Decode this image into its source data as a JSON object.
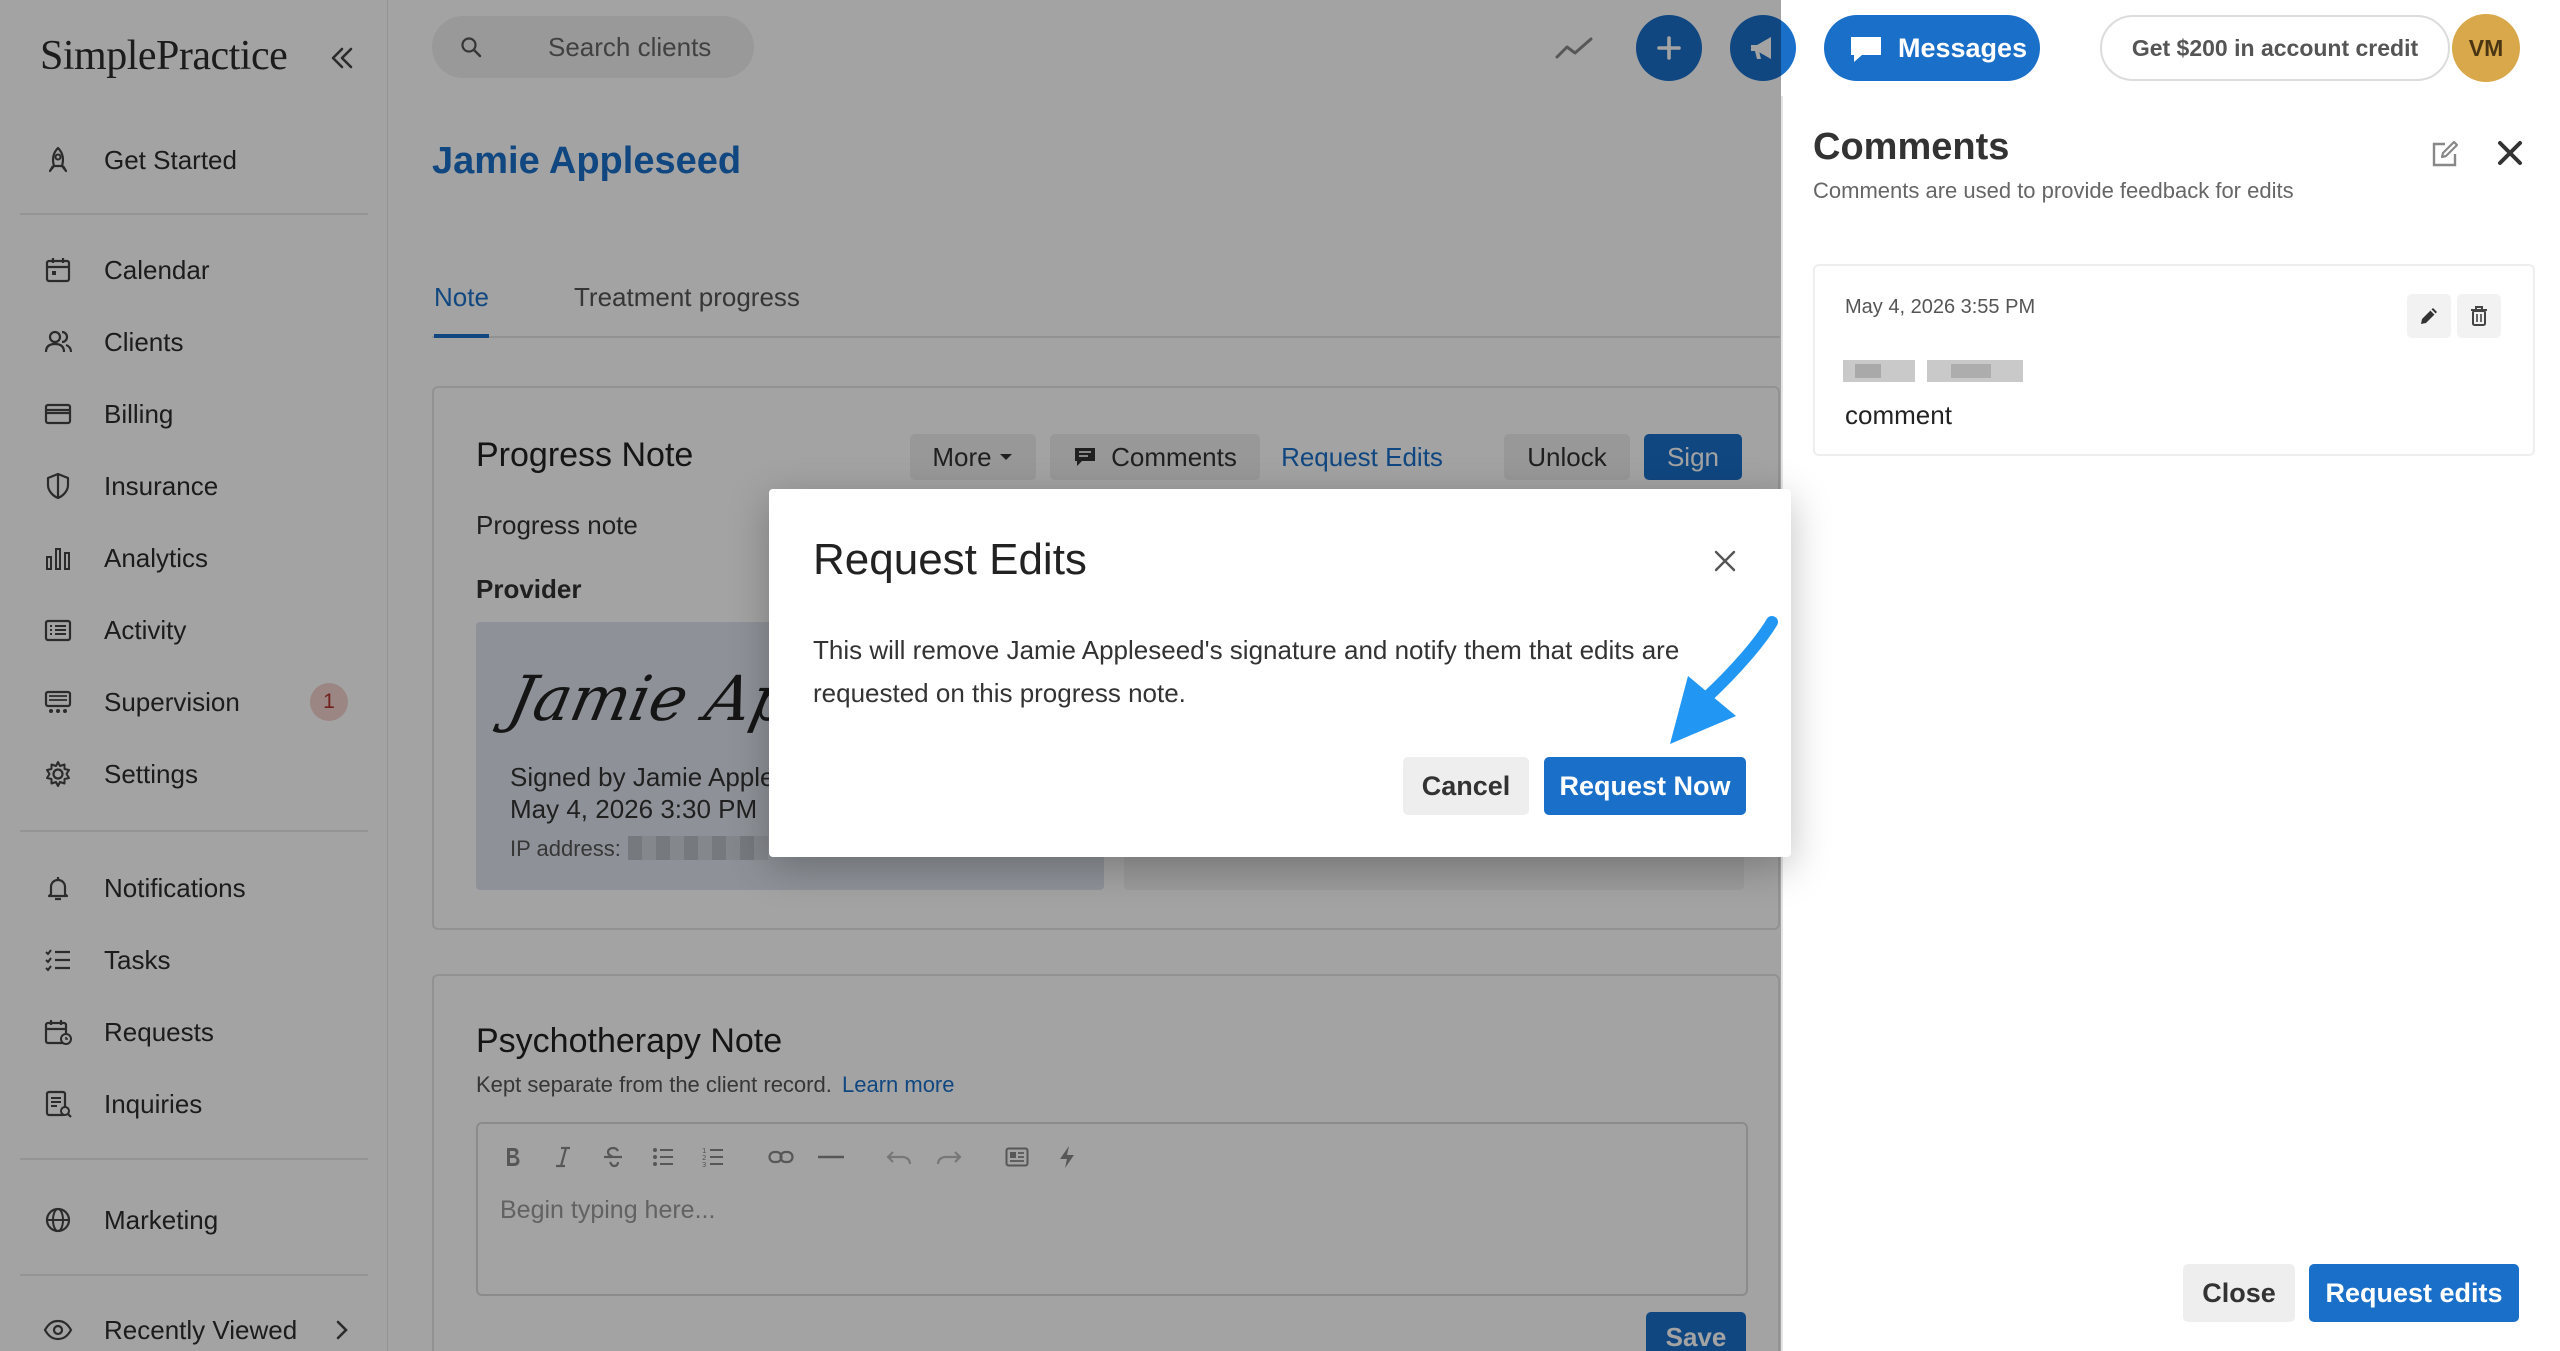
{
  "brand": {
    "logo_text": "SimplePractice"
  },
  "sidebar": {
    "items": [
      {
        "label": "Get Started",
        "icon": "rocket-icon"
      },
      {
        "label": "Calendar",
        "icon": "calendar-icon"
      },
      {
        "label": "Clients",
        "icon": "clients-icon"
      },
      {
        "label": "Billing",
        "icon": "credit-card-icon"
      },
      {
        "label": "Insurance",
        "icon": "shield-icon"
      },
      {
        "label": "Analytics",
        "icon": "bar-chart-icon"
      },
      {
        "label": "Activity",
        "icon": "activity-list-icon"
      },
      {
        "label": "Supervision",
        "icon": "supervision-icon",
        "badge": "1"
      },
      {
        "label": "Settings",
        "icon": "gear-icon"
      },
      {
        "label": "Notifications",
        "icon": "bell-icon"
      },
      {
        "label": "Tasks",
        "icon": "tasks-icon"
      },
      {
        "label": "Requests",
        "icon": "requests-icon"
      },
      {
        "label": "Inquiries",
        "icon": "inquiries-icon"
      },
      {
        "label": "Marketing",
        "icon": "globe-icon"
      },
      {
        "label": "Recently Viewed",
        "icon": "eye-icon"
      }
    ]
  },
  "topbar": {
    "search_placeholder": "Search clients",
    "messages_label": "Messages",
    "credit_label": "Get $200 in account credit",
    "avatar_initials": "VM"
  },
  "main": {
    "client_name": "Jamie Appleseed",
    "tabs": [
      {
        "label": "Note"
      },
      {
        "label": "Treatment progress"
      }
    ],
    "progress_note": {
      "title": "Progress Note",
      "actions": {
        "more": "More",
        "comments": "Comments",
        "request_edits": "Request Edits",
        "unlock": "Unlock",
        "sign": "Sign"
      },
      "subtitle": "Progress note",
      "provider_label": "Provider",
      "signature_script": "Jamie Appleseed",
      "signed_by": "Signed by Jamie Apple",
      "signed_date": "May 4, 2026 3:30 PM",
      "ip_label": "IP address:"
    },
    "psychotherapy_note": {
      "title": "Psychotherapy Note",
      "subtitle": "Kept separate from the client record.",
      "learn_more": "Learn more",
      "editor_placeholder": "Begin typing here...",
      "save_label": "Save"
    }
  },
  "modal": {
    "title": "Request Edits",
    "body": "This will remove Jamie Appleseed's signature and notify them that edits are requested on this progress note.",
    "cancel_label": "Cancel",
    "primary_label": "Request Now"
  },
  "comments_panel": {
    "title": "Comments",
    "subtitle": "Comments are used to provide feedback for edits",
    "comment": {
      "date": "May 4, 2026 3:55 PM",
      "text": "comment"
    },
    "close_label": "Close",
    "request_label": "Request edits"
  },
  "colors": {
    "accent": "#1a6fc9",
    "badge_bg": "#f4d2cf",
    "avatar_bg": "#d9a84a",
    "annotation_arrow": "#2196f3"
  }
}
